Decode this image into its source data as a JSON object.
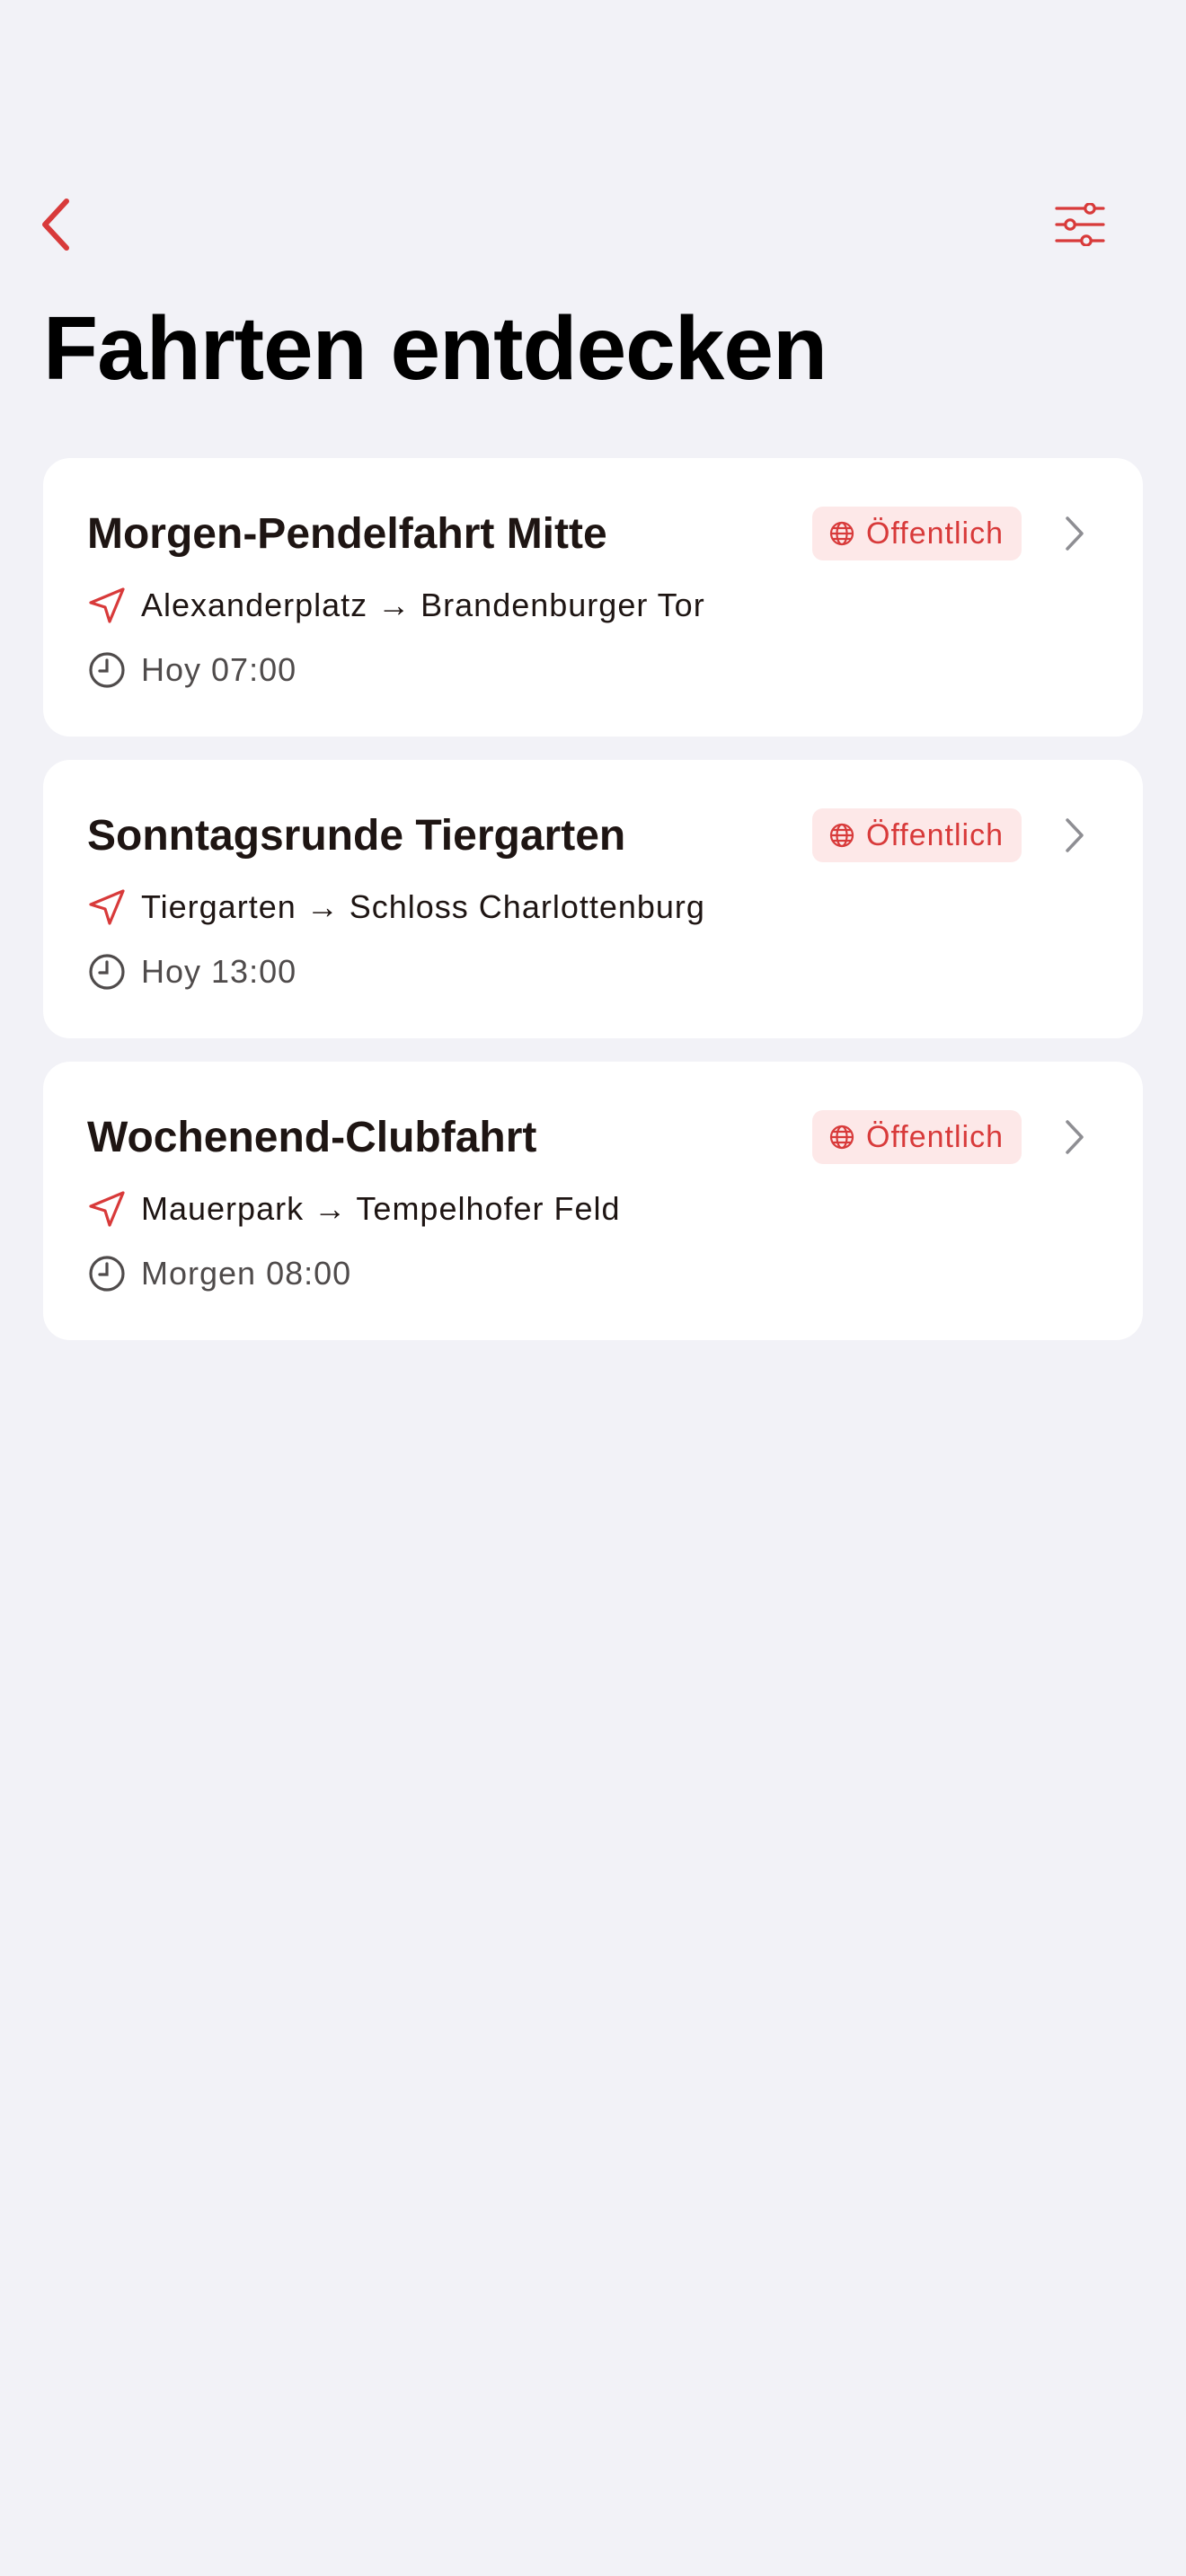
{
  "header": {
    "back_icon": "chevron-left-icon",
    "filter_icon": "sliders-icon",
    "title": "Fahrten entdecken"
  },
  "colors": {
    "accent": "#d83a3a",
    "badge_background": "#fde8e8",
    "page_background": "#f2f2f7",
    "card_background": "#ffffff",
    "chevron": "#8e8e93"
  },
  "rides": [
    {
      "title": "Morgen-Pendelfahrt Mitte",
      "visibility": "Öffentlich",
      "route": "Alexanderplatz → Brandenburger Tor",
      "time": "Hoy 07:00"
    },
    {
      "title": "Sonntagsrunde Tiergarten",
      "visibility": "Öffentlich",
      "route": "Tiergarten → Schloss Charlottenburg",
      "time": "Hoy 13:00"
    },
    {
      "title": "Wochenend-Clubfahrt",
      "visibility": "Öffentlich",
      "route": "Mauerpark → Tempelhofer Feld",
      "time": "Morgen 08:00"
    }
  ]
}
